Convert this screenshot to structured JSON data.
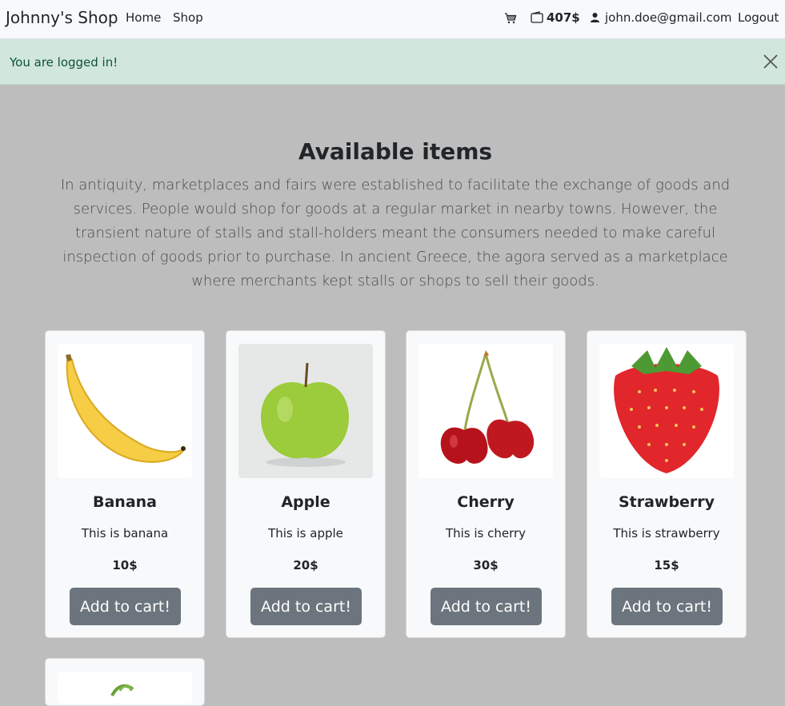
{
  "navbar": {
    "brand": "Johnny's Shop",
    "links": [
      "Home",
      "Shop"
    ],
    "balance": "407$",
    "email": "john.doe@gmail.com",
    "logout": "Logout"
  },
  "alert": {
    "message": "You are logged in!"
  },
  "main": {
    "title": "Available items",
    "description": "In antiquity, marketplaces and fairs were established to facilitate the exchange of goods and services. People would shop for goods at a regular market in nearby towns. However, the transient nature of stalls and stall-holders meant the consumers needed to make careful inspection of goods prior to purchase. In ancient Greece, the agora served as a marketplace where merchants kept stalls or shops to sell their goods."
  },
  "products": [
    {
      "name": "Banana",
      "description": "This is banana",
      "price": "10$",
      "button": "Add to cart!"
    },
    {
      "name": "Apple",
      "description": "This is apple",
      "price": "20$",
      "button": "Add to cart!"
    },
    {
      "name": "Cherry",
      "description": "This is cherry",
      "price": "30$",
      "button": "Add to cart!"
    },
    {
      "name": "Strawberry",
      "description": "This is strawberry",
      "price": "15$",
      "button": "Add to cart!"
    }
  ],
  "icons": [
    "cart-icon",
    "wallet-icon",
    "user-icon",
    "close-icon"
  ],
  "colors": {
    "alert_bg": "#d1e7dd",
    "alert_text": "#0f5132",
    "button": "#6c757d",
    "page_bg": "#bdbdbd"
  }
}
